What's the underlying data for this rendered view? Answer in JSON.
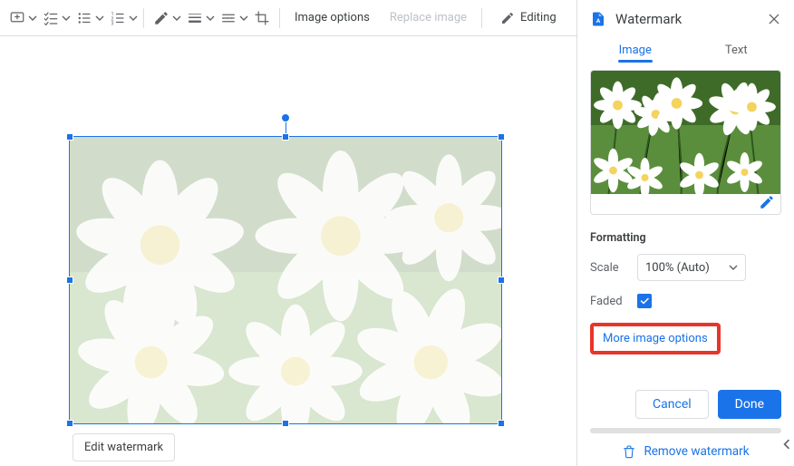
{
  "toolbar": {
    "image_options_label": "Image options",
    "replace_image_label": "Replace image",
    "editing_label": "Editing"
  },
  "canvas": {
    "edit_watermark_label": "Edit watermark"
  },
  "panel": {
    "title": "Watermark",
    "tabs": {
      "image": "Image",
      "text": "Text"
    },
    "formatting_label": "Formatting",
    "scale_label": "Scale",
    "scale_value": "100% (Auto)",
    "faded_label": "Faded",
    "faded_checked": true,
    "more_options_label": "More image options",
    "cancel_label": "Cancel",
    "done_label": "Done",
    "remove_label": "Remove watermark"
  },
  "colors": {
    "accent": "#1a73e8",
    "highlight_box": "#e8352a"
  }
}
